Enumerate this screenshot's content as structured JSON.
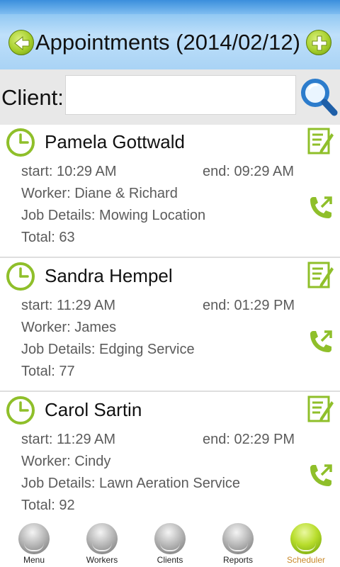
{
  "header": {
    "title": "Appointments (2014/02/12)",
    "back_icon": "arrow-left-icon",
    "add_icon": "plus-icon"
  },
  "search": {
    "label": "Client:",
    "value": "",
    "placeholder": "",
    "icon": "search-icon"
  },
  "appointments": [
    {
      "client": "Pamela Gottwald",
      "start": "start: 10:29 AM",
      "end": "end: 09:29 AM",
      "worker": "Worker: Diane & Richard",
      "job": "Job Details: Mowing Location",
      "total": "Total: 63"
    },
    {
      "client": "Sandra Hempel",
      "start": "start: 11:29 AM",
      "end": "end: 01:29 PM",
      "worker": "Worker: James",
      "job": "Job Details: Edging Service",
      "total": "Total: 77"
    },
    {
      "client": "Carol Sartin",
      "start": "start: 11:29 AM",
      "end": "end: 02:29 PM",
      "worker": "Worker: Cindy",
      "job": "Job Details: Lawn Aeration Service",
      "total": "Total: 92"
    }
  ],
  "nav": {
    "items": [
      "Menu",
      "Workers",
      "Clients",
      "Reports",
      "Scheduler"
    ],
    "active": "Scheduler"
  },
  "colors": {
    "accent_green": "#8fbf2a",
    "header_blue": "#8dc6f2",
    "active_label": "#c98a2c"
  }
}
